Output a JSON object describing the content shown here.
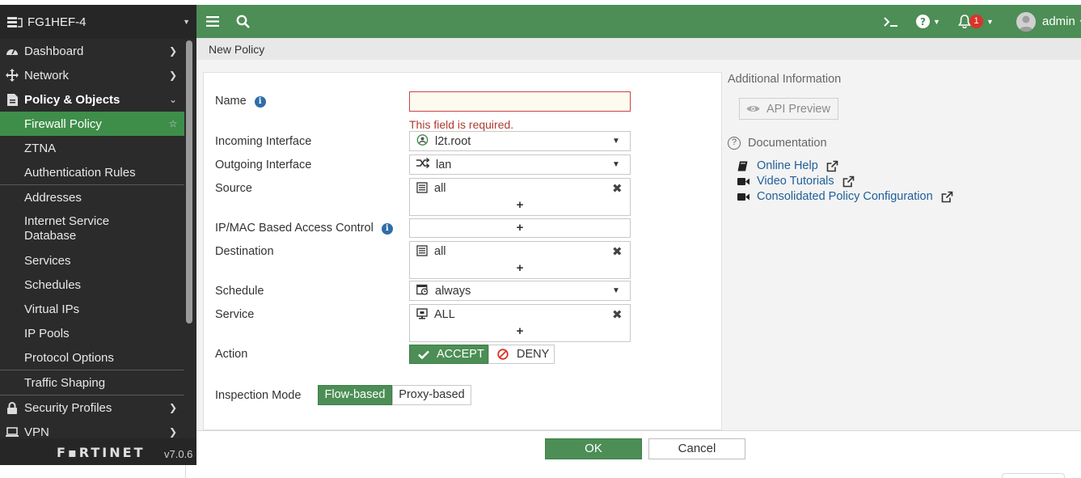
{
  "sidebar": {
    "device_name": "FG1HEF-4",
    "items": [
      {
        "label": "Dashboard",
        "icon": "dashboard-icon"
      },
      {
        "label": "Network",
        "icon": "network-icon"
      },
      {
        "label": "Policy & Objects",
        "icon": "policy-icon"
      },
      {
        "label": "Firewall Policy"
      },
      {
        "label": "ZTNA"
      },
      {
        "label": "Authentication Rules"
      },
      {
        "label": "Addresses"
      },
      {
        "label": "Internet Service Database"
      },
      {
        "label": "Services"
      },
      {
        "label": "Schedules"
      },
      {
        "label": "Virtual IPs"
      },
      {
        "label": "IP Pools"
      },
      {
        "label": "Protocol Options"
      },
      {
        "label": "Traffic Shaping"
      },
      {
        "label": "Security Profiles",
        "icon": "lock-icon"
      },
      {
        "label": "VPN",
        "icon": "laptop-icon"
      }
    ],
    "brand": "F▪RTINET",
    "version": "v7.0.6"
  },
  "topbar": {
    "notification_count": "1",
    "user": "admin",
    "accent": "#4c8e55"
  },
  "breadcrumb": "New Policy",
  "form": {
    "name_label": "Name",
    "name_value": "",
    "name_error": "This field is required.",
    "incoming_label": "Incoming Interface",
    "incoming_value": "l2t.root",
    "outgoing_label": "Outgoing Interface",
    "outgoing_value": "lan",
    "source_label": "Source",
    "source_value": "all",
    "ipmac_label": "IP/MAC Based Access Control",
    "destination_label": "Destination",
    "destination_value": "all",
    "schedule_label": "Schedule",
    "schedule_value": "always",
    "service_label": "Service",
    "service_value": "ALL",
    "action_label": "Action",
    "action_accept": "ACCEPT",
    "action_deny": "DENY",
    "inspection_label": "Inspection Mode",
    "inspection_flow": "Flow-based",
    "inspection_proxy": "Proxy-based",
    "plus": "+"
  },
  "right_panel": {
    "title": "Additional Information",
    "api_preview": "API Preview",
    "documentation": "Documentation",
    "links": [
      "Online Help",
      "Video Tutorials",
      "Consolidated Policy Configuration"
    ]
  },
  "footer": {
    "ok": "OK",
    "cancel": "Cancel"
  }
}
